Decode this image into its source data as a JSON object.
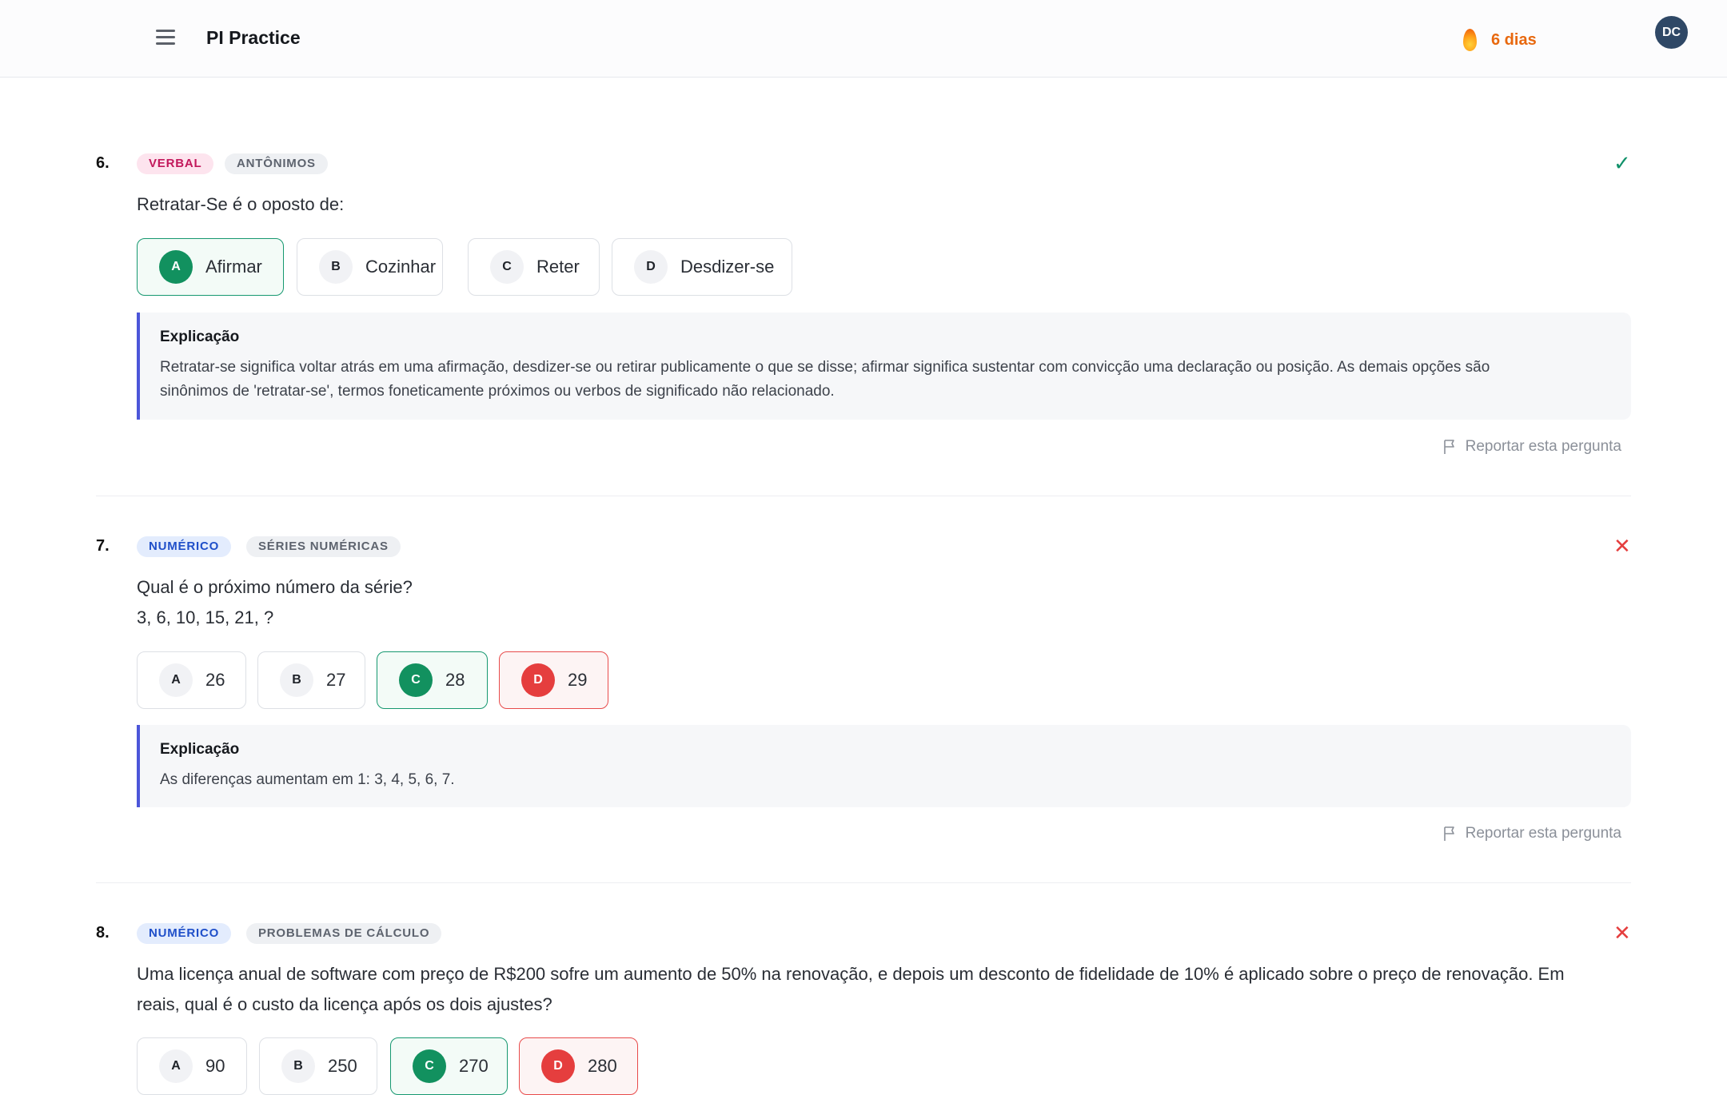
{
  "header": {
    "app_title": "PI Practice",
    "streak_text": "6 dias",
    "avatar_initials": "DC"
  },
  "icons": {
    "menu": "hamburger-menu-icon",
    "streak": "flame-icon",
    "correct": "check-icon",
    "incorrect": "x-icon",
    "report": "flag-icon"
  },
  "colors": {
    "correct": "#12915f",
    "wrong": "#e53e3e",
    "streak": "#e8680e",
    "explanation_accent": "#4c56d9"
  },
  "questions": [
    {
      "number": "6.",
      "category": "VERBAL",
      "subcategory": "ANTÔNIMOS",
      "result": "correct",
      "status_glyph": "✓",
      "text_lines": [
        "Retratar-Se é o oposto de:"
      ],
      "options": [
        {
          "letter": "A",
          "text": "Afirmar",
          "state": "correct"
        },
        {
          "letter": "B",
          "text": "Cozinhar",
          "state": "neutral"
        },
        {
          "letter": "C",
          "text": "Reter",
          "state": "neutral"
        },
        {
          "letter": "D",
          "text": "Desdizer-se",
          "state": "neutral"
        }
      ],
      "explanation_title": "Explicação",
      "explanation_lines": [
        "Retratar-se significa voltar atrás em uma afirmação, desdizer-se ou retirar publicamente o que se disse; afirmar significa sustentar com convicção uma declaração ou posição. As demais opções são",
        "sinônimos de 'retratar-se', termos foneticamente próximos ou verbos de significado não relacionado."
      ],
      "report_label": "Reportar esta pergunta"
    },
    {
      "number": "7.",
      "category": "NUMÉRICO",
      "subcategory": "SÉRIES NUMÉRICAS",
      "result": "incorrect",
      "status_glyph": "✕",
      "text_lines": [
        "Qual é o próximo número da série?",
        "3, 6, 10, 15, 21, ?"
      ],
      "options": [
        {
          "letter": "A",
          "text": "26",
          "state": "neutral"
        },
        {
          "letter": "B",
          "text": "27",
          "state": "neutral"
        },
        {
          "letter": "C",
          "text": "28",
          "state": "correct"
        },
        {
          "letter": "D",
          "text": "29",
          "state": "wrong"
        }
      ],
      "explanation_title": "Explicação",
      "explanation_lines": [
        "As diferenças aumentam em 1: 3, 4, 5, 6, 7."
      ],
      "report_label": "Reportar esta pergunta"
    },
    {
      "number": "8.",
      "category": "NUMÉRICO",
      "subcategory": "PROBLEMAS DE CÁLCULO",
      "result": "incorrect",
      "status_glyph": "✕",
      "text_lines": [
        "Uma licença anual de software com preço de R$200 sofre um aumento de 50% na renovação, e depois um desconto de fidelidade de 10% é aplicado sobre o preço de renovação. Em",
        "reais, qual é o custo da licença após os dois ajustes?"
      ],
      "options": [
        {
          "letter": "A",
          "text": "90",
          "state": "neutral"
        },
        {
          "letter": "B",
          "text": "250",
          "state": "neutral"
        },
        {
          "letter": "C",
          "text": "270",
          "state": "correct"
        },
        {
          "letter": "D",
          "text": "280",
          "state": "wrong"
        }
      ]
    }
  ]
}
